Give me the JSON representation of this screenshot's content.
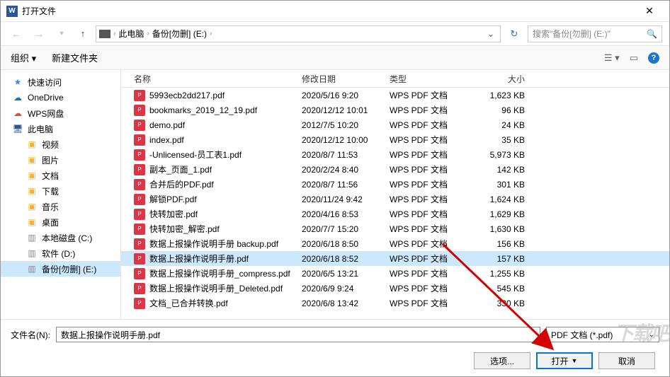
{
  "title": "打开文件",
  "breadcrumb": {
    "root": "此电脑",
    "drive": "备份[勿删] (E:)"
  },
  "search_placeholder": "搜索\"备份[勿删] (E:)\"",
  "toolbar": {
    "organize": "组织",
    "new_folder": "新建文件夹"
  },
  "sidebar": [
    {
      "icon": "star",
      "label": "快速访问",
      "nested": false
    },
    {
      "icon": "cloud",
      "label": "OneDrive",
      "nested": false
    },
    {
      "icon": "wps",
      "label": "WPS网盘",
      "nested": false
    },
    {
      "icon": "pc",
      "label": "此电脑",
      "nested": false,
      "selected": false
    },
    {
      "icon": "folder",
      "label": "视频",
      "nested": true
    },
    {
      "icon": "folder",
      "label": "图片",
      "nested": true
    },
    {
      "icon": "folder",
      "label": "文档",
      "nested": true
    },
    {
      "icon": "folder",
      "label": "下载",
      "nested": true
    },
    {
      "icon": "folder",
      "label": "音乐",
      "nested": true
    },
    {
      "icon": "folder",
      "label": "桌面",
      "nested": true
    },
    {
      "icon": "disk",
      "label": "本地磁盘 (C:)",
      "nested": true
    },
    {
      "icon": "disk",
      "label": "软件 (D:)",
      "nested": true
    },
    {
      "icon": "disk",
      "label": "备份[勿删] (E:)",
      "nested": true,
      "selected": true
    }
  ],
  "columns": {
    "name": "名称",
    "date": "修改日期",
    "type": "类型",
    "size": "大小"
  },
  "files": [
    {
      "name": "5993ecb2dd217.pdf",
      "date": "2020/5/16 9:20",
      "type": "WPS PDF 文档",
      "size": "1,623 KB"
    },
    {
      "name": "bookmarks_2019_12_19.pdf",
      "date": "2020/12/12 10:01",
      "type": "WPS PDF 文档",
      "size": "96 KB"
    },
    {
      "name": "demo.pdf",
      "date": "2012/7/5 10:20",
      "type": "WPS PDF 文档",
      "size": "24 KB"
    },
    {
      "name": "index.pdf",
      "date": "2020/12/12 10:00",
      "type": "WPS PDF 文档",
      "size": "35 KB"
    },
    {
      "name": "-Unlicensed-员工表1.pdf",
      "date": "2020/8/7 11:53",
      "type": "WPS PDF 文档",
      "size": "5,973 KB"
    },
    {
      "name": "副本_页面_1.pdf",
      "date": "2020/2/24 8:40",
      "type": "WPS PDF 文档",
      "size": "142 KB"
    },
    {
      "name": "合并后的PDF.pdf",
      "date": "2020/8/7 11:56",
      "type": "WPS PDF 文档",
      "size": "301 KB"
    },
    {
      "name": "解锁PDF.pdf",
      "date": "2020/11/24 9:42",
      "type": "WPS PDF 文档",
      "size": "1,624 KB"
    },
    {
      "name": "快转加密.pdf",
      "date": "2020/4/16 8:53",
      "type": "WPS PDF 文档",
      "size": "1,629 KB"
    },
    {
      "name": "快转加密_解密.pdf",
      "date": "2020/7/7 15:20",
      "type": "WPS PDF 文档",
      "size": "1,630 KB"
    },
    {
      "name": "数据上报操作说明手册  backup.pdf",
      "date": "2020/6/18 8:50",
      "type": "WPS PDF 文档",
      "size": "156 KB"
    },
    {
      "name": "数据上报操作说明手册.pdf",
      "date": "2020/6/18 8:52",
      "type": "WPS PDF 文档",
      "size": "157 KB",
      "selected": true
    },
    {
      "name": "数据上报操作说明手册_compress.pdf",
      "date": "2020/6/5 13:21",
      "type": "WPS PDF 文档",
      "size": "1,255 KB"
    },
    {
      "name": "数据上报操作说明手册_Deleted.pdf",
      "date": "2020/6/9 9:24",
      "type": "WPS PDF 文档",
      "size": "545 KB"
    },
    {
      "name": "文档_已合并转换.pdf",
      "date": "2020/6/8 13:42",
      "type": "WPS PDF 文档",
      "size": "330 KB"
    }
  ],
  "filename_label": "文件名(N):",
  "filename_value": "数据上报操作说明手册.pdf",
  "filetype": "PDF 文档 (*.pdf)",
  "buttons": {
    "options": "选项...",
    "open": "打开",
    "cancel": "取消"
  },
  "watermark": "下载吧"
}
